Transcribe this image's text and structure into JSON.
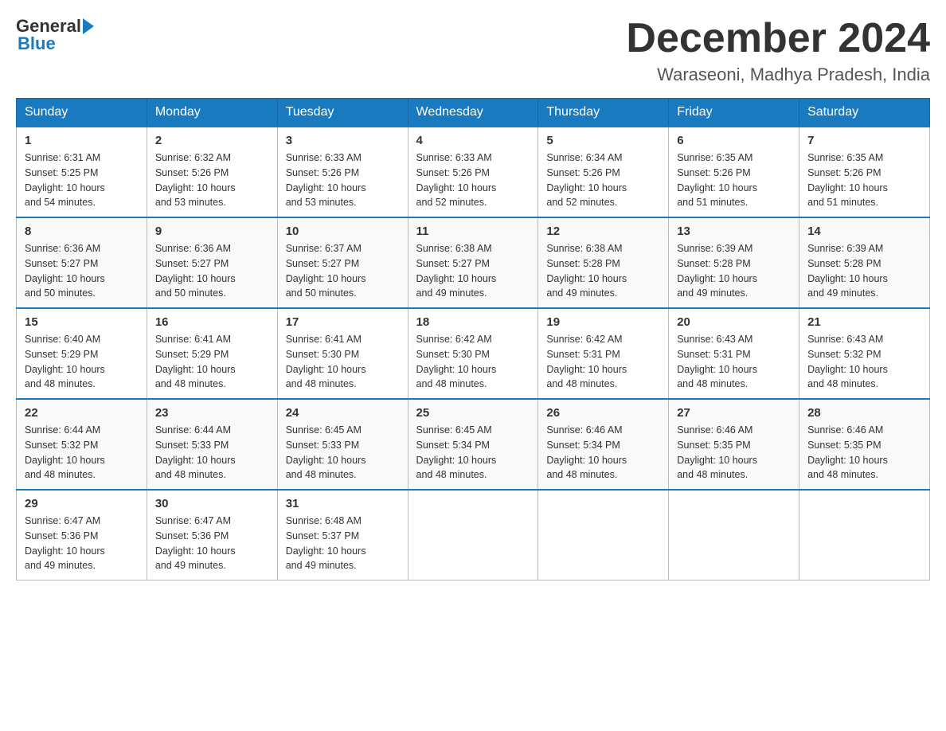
{
  "header": {
    "logo_general": "General",
    "logo_blue": "Blue",
    "month_title": "December 2024",
    "location": "Waraseoni, Madhya Pradesh, India"
  },
  "days_of_week": [
    "Sunday",
    "Monday",
    "Tuesday",
    "Wednesday",
    "Thursday",
    "Friday",
    "Saturday"
  ],
  "weeks": [
    [
      {
        "day": "1",
        "sunrise": "6:31 AM",
        "sunset": "5:25 PM",
        "daylight": "10 hours and 54 minutes."
      },
      {
        "day": "2",
        "sunrise": "6:32 AM",
        "sunset": "5:26 PM",
        "daylight": "10 hours and 53 minutes."
      },
      {
        "day": "3",
        "sunrise": "6:33 AM",
        "sunset": "5:26 PM",
        "daylight": "10 hours and 53 minutes."
      },
      {
        "day": "4",
        "sunrise": "6:33 AM",
        "sunset": "5:26 PM",
        "daylight": "10 hours and 52 minutes."
      },
      {
        "day": "5",
        "sunrise": "6:34 AM",
        "sunset": "5:26 PM",
        "daylight": "10 hours and 52 minutes."
      },
      {
        "day": "6",
        "sunrise": "6:35 AM",
        "sunset": "5:26 PM",
        "daylight": "10 hours and 51 minutes."
      },
      {
        "day": "7",
        "sunrise": "6:35 AM",
        "sunset": "5:26 PM",
        "daylight": "10 hours and 51 minutes."
      }
    ],
    [
      {
        "day": "8",
        "sunrise": "6:36 AM",
        "sunset": "5:27 PM",
        "daylight": "10 hours and 50 minutes."
      },
      {
        "day": "9",
        "sunrise": "6:36 AM",
        "sunset": "5:27 PM",
        "daylight": "10 hours and 50 minutes."
      },
      {
        "day": "10",
        "sunrise": "6:37 AM",
        "sunset": "5:27 PM",
        "daylight": "10 hours and 50 minutes."
      },
      {
        "day": "11",
        "sunrise": "6:38 AM",
        "sunset": "5:27 PM",
        "daylight": "10 hours and 49 minutes."
      },
      {
        "day": "12",
        "sunrise": "6:38 AM",
        "sunset": "5:28 PM",
        "daylight": "10 hours and 49 minutes."
      },
      {
        "day": "13",
        "sunrise": "6:39 AM",
        "sunset": "5:28 PM",
        "daylight": "10 hours and 49 minutes."
      },
      {
        "day": "14",
        "sunrise": "6:39 AM",
        "sunset": "5:28 PM",
        "daylight": "10 hours and 49 minutes."
      }
    ],
    [
      {
        "day": "15",
        "sunrise": "6:40 AM",
        "sunset": "5:29 PM",
        "daylight": "10 hours and 48 minutes."
      },
      {
        "day": "16",
        "sunrise": "6:41 AM",
        "sunset": "5:29 PM",
        "daylight": "10 hours and 48 minutes."
      },
      {
        "day": "17",
        "sunrise": "6:41 AM",
        "sunset": "5:30 PM",
        "daylight": "10 hours and 48 minutes."
      },
      {
        "day": "18",
        "sunrise": "6:42 AM",
        "sunset": "5:30 PM",
        "daylight": "10 hours and 48 minutes."
      },
      {
        "day": "19",
        "sunrise": "6:42 AM",
        "sunset": "5:31 PM",
        "daylight": "10 hours and 48 minutes."
      },
      {
        "day": "20",
        "sunrise": "6:43 AM",
        "sunset": "5:31 PM",
        "daylight": "10 hours and 48 minutes."
      },
      {
        "day": "21",
        "sunrise": "6:43 AM",
        "sunset": "5:32 PM",
        "daylight": "10 hours and 48 minutes."
      }
    ],
    [
      {
        "day": "22",
        "sunrise": "6:44 AM",
        "sunset": "5:32 PM",
        "daylight": "10 hours and 48 minutes."
      },
      {
        "day": "23",
        "sunrise": "6:44 AM",
        "sunset": "5:33 PM",
        "daylight": "10 hours and 48 minutes."
      },
      {
        "day": "24",
        "sunrise": "6:45 AM",
        "sunset": "5:33 PM",
        "daylight": "10 hours and 48 minutes."
      },
      {
        "day": "25",
        "sunrise": "6:45 AM",
        "sunset": "5:34 PM",
        "daylight": "10 hours and 48 minutes."
      },
      {
        "day": "26",
        "sunrise": "6:46 AM",
        "sunset": "5:34 PM",
        "daylight": "10 hours and 48 minutes."
      },
      {
        "day": "27",
        "sunrise": "6:46 AM",
        "sunset": "5:35 PM",
        "daylight": "10 hours and 48 minutes."
      },
      {
        "day": "28",
        "sunrise": "6:46 AM",
        "sunset": "5:35 PM",
        "daylight": "10 hours and 48 minutes."
      }
    ],
    [
      {
        "day": "29",
        "sunrise": "6:47 AM",
        "sunset": "5:36 PM",
        "daylight": "10 hours and 49 minutes."
      },
      {
        "day": "30",
        "sunrise": "6:47 AM",
        "sunset": "5:36 PM",
        "daylight": "10 hours and 49 minutes."
      },
      {
        "day": "31",
        "sunrise": "6:48 AM",
        "sunset": "5:37 PM",
        "daylight": "10 hours and 49 minutes."
      },
      null,
      null,
      null,
      null
    ]
  ],
  "labels": {
    "sunrise": "Sunrise:",
    "sunset": "Sunset:",
    "daylight": "Daylight:"
  },
  "colors": {
    "header_bg": "#1a7abf",
    "accent_blue": "#1a7abf"
  }
}
